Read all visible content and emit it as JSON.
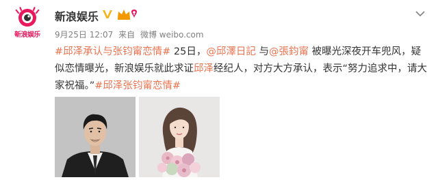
{
  "account": {
    "name": "新浪娱乐",
    "avatar_text": "新浪娱乐",
    "verified_icon": "verified-v-icon",
    "badge_icon": "vip-crown-icon"
  },
  "meta": {
    "date": "9月25日 12:07",
    "source_prefix": "来自",
    "source": "微博 weibo.com"
  },
  "post": {
    "parts": [
      {
        "type": "link",
        "text": "#邱泽承认与张钧甯恋情#"
      },
      {
        "type": "text",
        "text": " 25日，"
      },
      {
        "type": "link",
        "text": "@邱澤日記"
      },
      {
        "type": "text",
        "text": " 与"
      },
      {
        "type": "link",
        "text": "@張鈞甯"
      },
      {
        "type": "text",
        "text": " 被曝光深夜开车兜风，疑似恋情曝光，新浪娱乐就此求证"
      },
      {
        "type": "highlight",
        "text": "邱泽"
      },
      {
        "type": "text",
        "text": "经纪人，对方大方承认，表示“努力追求中，请大家祝福。”"
      },
      {
        "type": "link",
        "text": "#邱泽张钧甯恋情#"
      }
    ]
  },
  "photos": [
    {
      "subject": "man-in-suit-portrait"
    },
    {
      "subject": "woman-with-flowers-portrait"
    }
  ],
  "colors": {
    "link": "#eb7350",
    "verified": "#f6b41b",
    "brand": "#e8195d",
    "meta": "#808080",
    "text": "#333333"
  }
}
